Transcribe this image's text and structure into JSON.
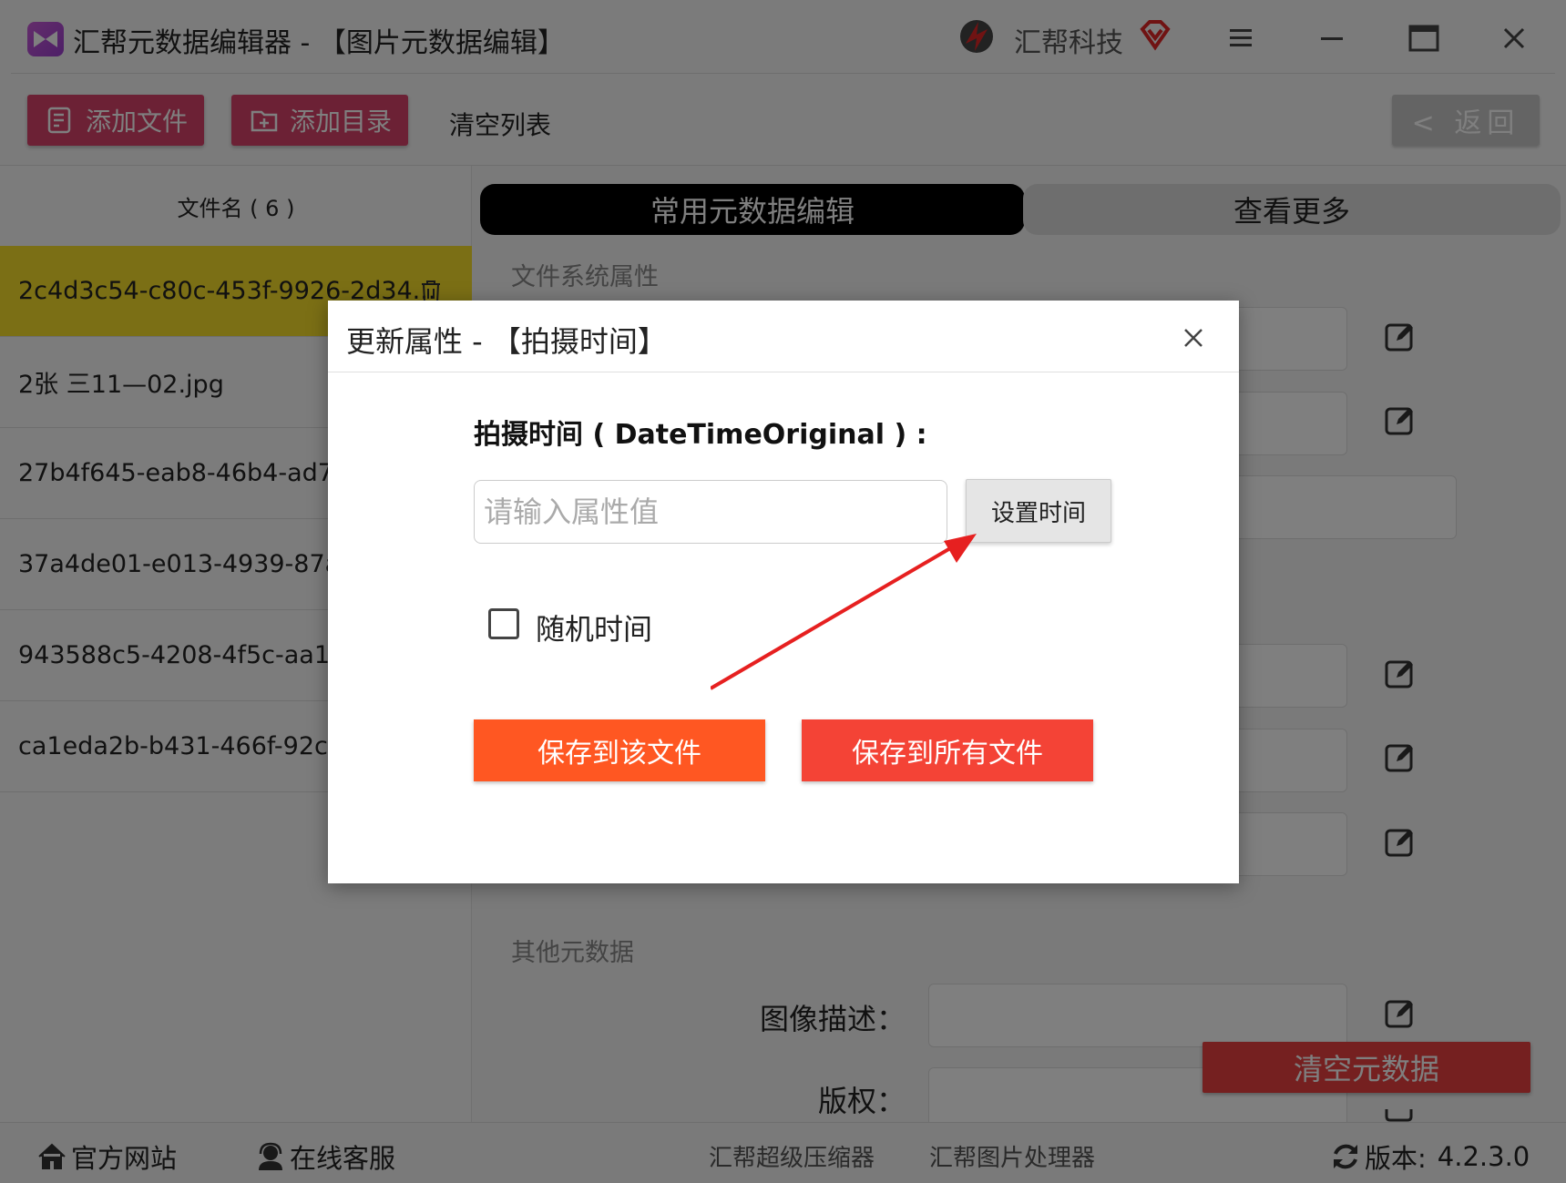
{
  "app": {
    "title": "汇帮元数据编辑器 - 【图片元数据编辑】",
    "brand": "汇帮科技"
  },
  "toolbar": {
    "add_file": "添加文件",
    "add_dir": "添加目录",
    "clear_list": "清空列表",
    "back": "< 返回"
  },
  "file_list": {
    "header": "文件名 ( 6 )",
    "items": [
      {
        "name": "2c4d3c54-c80c-453f-9926-2d34..."
      },
      {
        "name": "2张 三11—02.jpg"
      },
      {
        "name": "27b4f645-eab8-46b4-ad7"
      },
      {
        "name": "37a4de01-e013-4939-87a"
      },
      {
        "name": "943588c5-4208-4f5c-aa1a"
      },
      {
        "name": "ca1eda2b-b431-466f-92c"
      }
    ]
  },
  "tabs": {
    "common": "常用元数据编辑",
    "more": "查看更多"
  },
  "sections": {
    "file_system": "文件系统属性",
    "other": "其他元数据"
  },
  "fields": {
    "image_desc": "图像描述：",
    "copyright": "版权："
  },
  "clear_metadata": "清空元数据",
  "statusbar": {
    "website": "官方网站",
    "support": "在线客服",
    "compressor": "汇帮超级压缩器",
    "image_processor": "汇帮图片处理器",
    "version_label": "版本:",
    "version": "4.2.3.0"
  },
  "modal": {
    "title": "更新属性 - 【拍摄时间】",
    "prop_label": "拍摄时间 ( DateTimeOriginal ) :",
    "input_placeholder": "请输入属性值",
    "input_value": "",
    "set_time": "设置时间",
    "random_time": "随机时间",
    "random_checked": false,
    "save_one": "保存到该文件",
    "save_all": "保存到所有文件"
  },
  "colors": {
    "primary_pink": "#d9436b",
    "selected_row": "#f7df2b",
    "save_one": "#ff5722",
    "save_all": "#f44336",
    "arrow": "#e62020"
  }
}
